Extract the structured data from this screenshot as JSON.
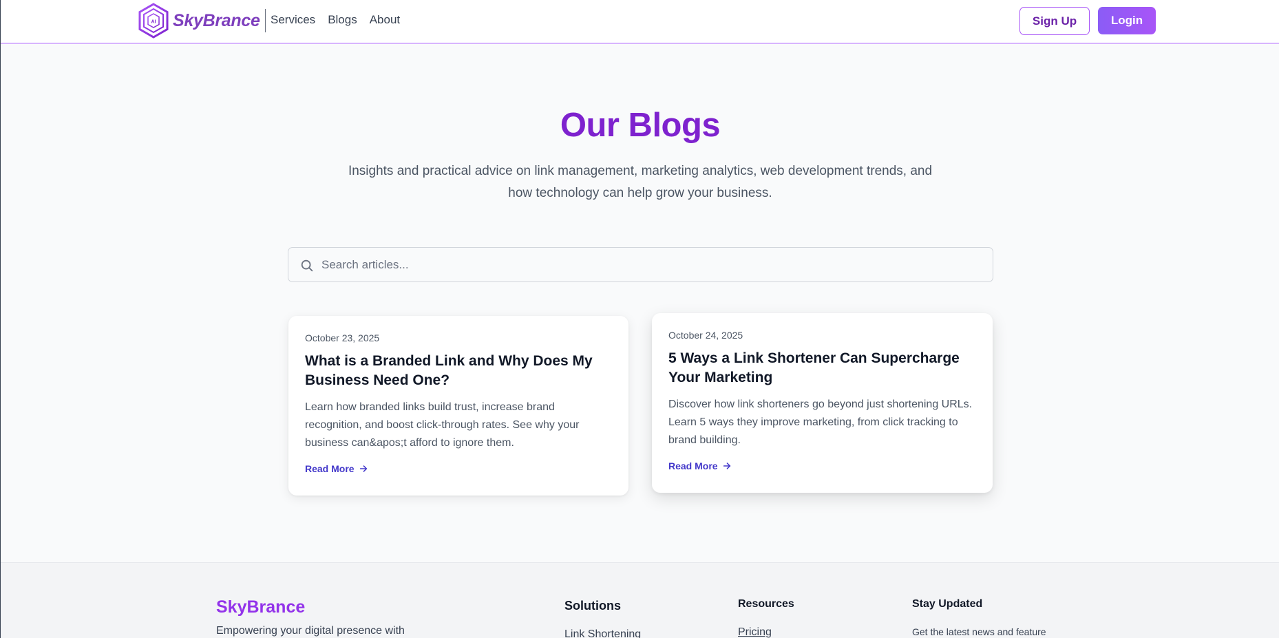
{
  "brand": {
    "name": "SkyBrance",
    "logo_icon": "hexagon-ai-icon",
    "colors": {
      "primary": "#7e22ce",
      "accent": "#a855f7",
      "link": "#4338ca"
    }
  },
  "nav": {
    "items": [
      "Services",
      "Blogs",
      "About"
    ]
  },
  "auth": {
    "signup_label": "Sign Up",
    "login_label": "Login"
  },
  "hero": {
    "title": "Our Blogs",
    "subtitle": "Insights and practical advice on link management, marketing analytics, web development trends, and how technology can help grow your business."
  },
  "search": {
    "placeholder": "Search articles...",
    "value": "",
    "icon": "search-icon"
  },
  "posts": [
    {
      "date": "October 23, 2025",
      "title": "What is a Branded Link and Why Does My Business Need One?",
      "excerpt": "Learn how branded links build trust, increase brand recognition, and boost click-through rates. See why your business can&apos;t afford to ignore them.",
      "cta": "Read More"
    },
    {
      "date": "October 24, 2025",
      "title": "5 Ways a Link Shortener Can Supercharge Your Marketing",
      "excerpt": "Discover how link shorteners go beyond just shortening URLs. Learn 5 ways they improve marketing, from click tracking to brand building.",
      "cta": "Read More"
    }
  ],
  "footer": {
    "brand": "SkyBrance",
    "description": "Empowering your digital presence with",
    "columns": [
      {
        "title": "Solutions",
        "links": [
          "Link Shortening"
        ]
      },
      {
        "title": "Resources",
        "links": [
          "Pricing"
        ]
      },
      {
        "title": "Stay Updated",
        "text": "Get the latest news and feature"
      }
    ]
  }
}
